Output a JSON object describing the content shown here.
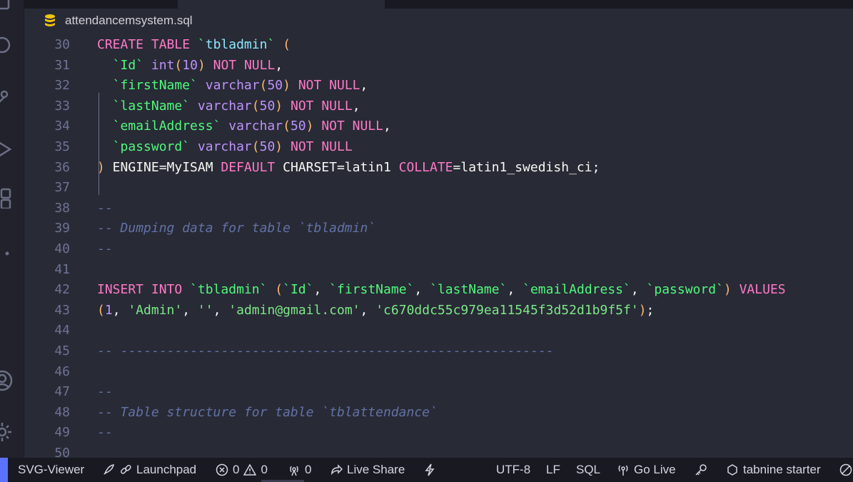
{
  "file": {
    "name": "attendancemsystem.sql",
    "icon": "database-icon"
  },
  "editor": {
    "lines": [
      {
        "n": "30",
        "tokens": [
          [
            "kw",
            "CREATE TABLE "
          ],
          [
            "id",
            "`"
          ],
          [
            "tn",
            "tbladmin"
          ],
          [
            "id",
            "`"
          ],
          [
            "pl",
            " "
          ],
          [
            "br",
            "("
          ]
        ]
      },
      {
        "n": "31",
        "tokens": [
          [
            "pl",
            "  "
          ],
          [
            "id",
            "`Id`"
          ],
          [
            "pl",
            " "
          ],
          [
            "ty",
            "int"
          ],
          [
            "br",
            "("
          ],
          [
            "num",
            "10"
          ],
          [
            "br",
            ")"
          ],
          [
            "pl",
            " "
          ],
          [
            "kw",
            "NOT NULL"
          ],
          [
            "pl",
            ","
          ]
        ]
      },
      {
        "n": "32",
        "tokens": [
          [
            "pl",
            "  "
          ],
          [
            "id",
            "`firstName`"
          ],
          [
            "pl",
            " "
          ],
          [
            "ty",
            "varchar"
          ],
          [
            "br",
            "("
          ],
          [
            "num",
            "50"
          ],
          [
            "br",
            ")"
          ],
          [
            "pl",
            " "
          ],
          [
            "kw",
            "NOT NULL"
          ],
          [
            "pl",
            ","
          ]
        ]
      },
      {
        "n": "33",
        "tokens": [
          [
            "pl",
            "  "
          ],
          [
            "id",
            "`lastName`"
          ],
          [
            "pl",
            " "
          ],
          [
            "ty",
            "varchar"
          ],
          [
            "br",
            "("
          ],
          [
            "num",
            "50"
          ],
          [
            "br",
            ")"
          ],
          [
            "pl",
            " "
          ],
          [
            "kw",
            "NOT NULL"
          ],
          [
            "pl",
            ","
          ]
        ]
      },
      {
        "n": "34",
        "tokens": [
          [
            "pl",
            "  "
          ],
          [
            "id",
            "`emailAddress`"
          ],
          [
            "pl",
            " "
          ],
          [
            "ty",
            "varchar"
          ],
          [
            "br",
            "("
          ],
          [
            "num",
            "50"
          ],
          [
            "br",
            ")"
          ],
          [
            "pl",
            " "
          ],
          [
            "kw",
            "NOT NULL"
          ],
          [
            "pl",
            ","
          ]
        ]
      },
      {
        "n": "35",
        "tokens": [
          [
            "pl",
            "  "
          ],
          [
            "id",
            "`password`"
          ],
          [
            "pl",
            " "
          ],
          [
            "ty",
            "varchar"
          ],
          [
            "br",
            "("
          ],
          [
            "num",
            "50"
          ],
          [
            "br",
            ")"
          ],
          [
            "pl",
            " "
          ],
          [
            "kw",
            "NOT NULL"
          ]
        ]
      },
      {
        "n": "36",
        "tokens": [
          [
            "br",
            ")"
          ],
          [
            "pl",
            " ENGINE=MyISAM "
          ],
          [
            "kw",
            "DEFAULT"
          ],
          [
            "pl",
            " CHARSET=latin1 "
          ],
          [
            "kw",
            "COLLATE"
          ],
          [
            "pl",
            "=latin1_swedish_ci;"
          ]
        ]
      },
      {
        "n": "37",
        "tokens": []
      },
      {
        "n": "38",
        "tokens": [
          [
            "cmn",
            "--"
          ]
        ]
      },
      {
        "n": "39",
        "tokens": [
          [
            "cmn",
            "-- "
          ],
          [
            "cm",
            "Dumping data for table `tbladmin`"
          ]
        ]
      },
      {
        "n": "40",
        "tokens": [
          [
            "cmn",
            "--"
          ]
        ]
      },
      {
        "n": "41",
        "tokens": []
      },
      {
        "n": "42",
        "tokens": [
          [
            "kw",
            "INSERT INTO "
          ],
          [
            "id",
            "`tbladmin`"
          ],
          [
            "pl",
            " "
          ],
          [
            "br",
            "("
          ],
          [
            "id",
            "`Id`"
          ],
          [
            "pl",
            ", "
          ],
          [
            "id",
            "`firstName`"
          ],
          [
            "pl",
            ", "
          ],
          [
            "id",
            "`lastName`"
          ],
          [
            "pl",
            ", "
          ],
          [
            "id",
            "`emailAddress`"
          ],
          [
            "pl",
            ", "
          ],
          [
            "id",
            "`password`"
          ],
          [
            "br",
            ")"
          ],
          [
            "pl",
            " "
          ],
          [
            "kw",
            "VALUES"
          ]
        ]
      },
      {
        "n": "43",
        "tokens": [
          [
            "br",
            "("
          ],
          [
            "num",
            "1"
          ],
          [
            "pl",
            ", "
          ],
          [
            "strg",
            "'Admin'"
          ],
          [
            "pl",
            ", "
          ],
          [
            "strg",
            "''"
          ],
          [
            "pl",
            ", "
          ],
          [
            "strg",
            "'admin@gmail.com'"
          ],
          [
            "pl",
            ", "
          ],
          [
            "strg",
            "'c670ddc55c979ea11545f3d52d1b9f5f'"
          ],
          [
            "br",
            ")"
          ],
          [
            "pl",
            ";"
          ]
        ]
      },
      {
        "n": "44",
        "tokens": []
      },
      {
        "n": "45",
        "tokens": [
          [
            "cmn",
            "-- --------------------------------------------------------"
          ]
        ]
      },
      {
        "n": "46",
        "tokens": []
      },
      {
        "n": "47",
        "tokens": [
          [
            "cmn",
            "--"
          ]
        ]
      },
      {
        "n": "48",
        "tokens": [
          [
            "cmn",
            "-- "
          ],
          [
            "cm",
            "Table structure for table `tblattendance`"
          ]
        ]
      },
      {
        "n": "49",
        "tokens": [
          [
            "cmn",
            "--"
          ]
        ]
      },
      {
        "n": "50",
        "tokens": []
      }
    ]
  },
  "status_bar": {
    "svg_viewer": "SVG-Viewer",
    "launchpad": "Launchpad",
    "errors": "0",
    "warnings": "0",
    "ports": "0",
    "live_share": "Live Share",
    "encoding": "UTF-8",
    "eol": "LF",
    "language": "SQL",
    "go_live": "Go Live",
    "tabnine": "tabnine starter"
  },
  "colors": {
    "background": "#282a36",
    "statusbar": "#191a21",
    "accent": "#5b72ff"
  }
}
